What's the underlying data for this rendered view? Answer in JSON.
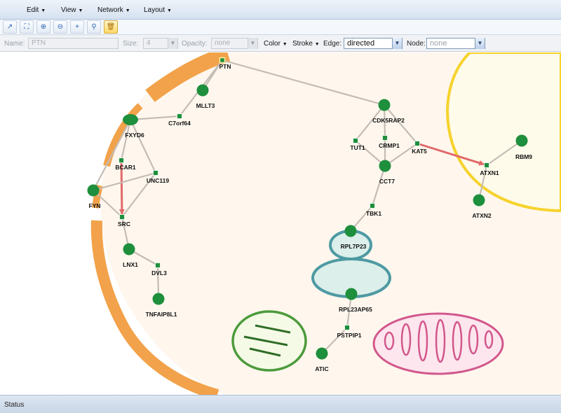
{
  "menubar": {
    "items": [
      "Edit",
      "View",
      "Network",
      "Layout"
    ]
  },
  "toolbar": {
    "buttons": [
      {
        "icon": "arrow-icon",
        "glyph": "↗"
      },
      {
        "icon": "fit-icon",
        "glyph": "⛶"
      },
      {
        "icon": "zoom-in-icon",
        "glyph": "⊕"
      },
      {
        "icon": "zoom-out-icon",
        "glyph": "⊖"
      },
      {
        "icon": "add-icon",
        "glyph": "+"
      },
      {
        "icon": "link-icon",
        "glyph": "⚲"
      },
      {
        "icon": "trash-icon",
        "glyph": "🗑"
      }
    ]
  },
  "properties": {
    "name_label": "Name:",
    "name_value": "PTN",
    "size_label": "Size:",
    "size_value": "4",
    "opacity_label": "Opacity:",
    "opacity_value": "none",
    "color_label": "Color",
    "stroke_label": "Stroke",
    "edge_label": "Edge:",
    "edge_value": "directed",
    "node_label": "Node:",
    "node_value": "none"
  },
  "graph": {
    "nodes": [
      {
        "id": "PTN",
        "label": "PTN",
        "shape": "square"
      },
      {
        "id": "MLLT3",
        "label": "MLLT3",
        "shape": "circle"
      },
      {
        "id": "C7orf64",
        "label": "C7orf64",
        "shape": "square"
      },
      {
        "id": "FXYD6",
        "label": "FXYD6",
        "shape": "ellipse"
      },
      {
        "id": "BCAR1",
        "label": "BCAR1",
        "shape": "square"
      },
      {
        "id": "UNC119",
        "label": "UNC119",
        "shape": "square"
      },
      {
        "id": "FYN",
        "label": "FYN",
        "shape": "circle"
      },
      {
        "id": "SRC",
        "label": "SRC",
        "shape": "square"
      },
      {
        "id": "LNX1",
        "label": "LNX1",
        "shape": "circle"
      },
      {
        "id": "DVL3",
        "label": "DVL3",
        "shape": "square"
      },
      {
        "id": "TNFAIP8L1",
        "label": "TNFAIP8L1",
        "shape": "circle"
      },
      {
        "id": "CDK5RAP2",
        "label": "CDK5RAP2",
        "shape": "circle"
      },
      {
        "id": "TUT1",
        "label": "TUT1",
        "shape": "square"
      },
      {
        "id": "CRMP1",
        "label": "CRMP1",
        "shape": "square"
      },
      {
        "id": "KAT5",
        "label": "KAT5",
        "shape": "square"
      },
      {
        "id": "CCT7",
        "label": "CCT7",
        "shape": "circle"
      },
      {
        "id": "TBK1",
        "label": "TBK1",
        "shape": "square"
      },
      {
        "id": "RPL7P23",
        "label": "RPL7P23",
        "shape": "circle"
      },
      {
        "id": "RPL23AP65",
        "label": "RPL23AP65",
        "shape": "circle"
      },
      {
        "id": "PSTPIP1",
        "label": "PSTPIP1",
        "shape": "square"
      },
      {
        "id": "ATIC",
        "label": "ATIC",
        "shape": "circle"
      },
      {
        "id": "ATXN1",
        "label": "ATXN1",
        "shape": "square"
      },
      {
        "id": "RBM9",
        "label": "RBM9",
        "shape": "circle"
      },
      {
        "id": "ATXN2",
        "label": "ATXN2",
        "shape": "circle"
      }
    ],
    "edges": [
      {
        "source": "PTN",
        "target": "MLLT3",
        "directed": false
      },
      {
        "source": "PTN",
        "target": "C7orf64",
        "directed": false
      },
      {
        "source": "PTN",
        "target": "CDK5RAP2",
        "directed": false
      },
      {
        "source": "C7orf64",
        "target": "FXYD6",
        "directed": false
      },
      {
        "source": "FXYD6",
        "target": "BCAR1",
        "directed": false
      },
      {
        "source": "FXYD6",
        "target": "UNC119",
        "directed": false
      },
      {
        "source": "FXYD6",
        "target": "FYN",
        "directed": false
      },
      {
        "source": "BCAR1",
        "target": "SRC",
        "directed": true
      },
      {
        "source": "UNC119",
        "target": "FYN",
        "directed": false
      },
      {
        "source": "UNC119",
        "target": "SRC",
        "directed": false
      },
      {
        "source": "FYN",
        "target": "SRC",
        "directed": false
      },
      {
        "source": "SRC",
        "target": "LNX1",
        "directed": false
      },
      {
        "source": "LNX1",
        "target": "DVL3",
        "directed": false
      },
      {
        "source": "DVL3",
        "target": "TNFAIP8L1",
        "directed": false
      },
      {
        "source": "CDK5RAP2",
        "target": "TUT1",
        "directed": false
      },
      {
        "source": "CDK5RAP2",
        "target": "CRMP1",
        "directed": false
      },
      {
        "source": "CDK5RAP2",
        "target": "KAT5",
        "directed": false
      },
      {
        "source": "TUT1",
        "target": "CCT7",
        "directed": false
      },
      {
        "source": "CRMP1",
        "target": "CCT7",
        "directed": false
      },
      {
        "source": "KAT5",
        "target": "CCT7",
        "directed": false
      },
      {
        "source": "KAT5",
        "target": "ATXN1",
        "directed": true
      },
      {
        "source": "CCT7",
        "target": "TBK1",
        "directed": false
      },
      {
        "source": "TBK1",
        "target": "RPL7P23",
        "directed": false
      },
      {
        "source": "RPL23AP65",
        "target": "PSTPIP1",
        "directed": false
      },
      {
        "source": "PSTPIP1",
        "target": "ATIC",
        "directed": false
      },
      {
        "source": "ATXN1",
        "target": "RBM9",
        "directed": false
      },
      {
        "source": "ATXN1",
        "target": "ATXN2",
        "directed": false
      }
    ]
  },
  "colors": {
    "node": "#1e8f3c",
    "edge": "#c4bdb5",
    "directed_edge": "#e16a6a",
    "membrane": "#f2a24a",
    "cytoplasm": "#fff7ee",
    "nucleus_border": "#f6d32d",
    "nucleus_fill": "#fffbea",
    "er_border": "#4e9aa3",
    "er_fill": "#dcefea",
    "chloroplast_border": "#4c9b3c",
    "chloroplast_fill": "#f5fae6",
    "mitochondrion": "#d2578c"
  },
  "status": {
    "text": "Status"
  }
}
